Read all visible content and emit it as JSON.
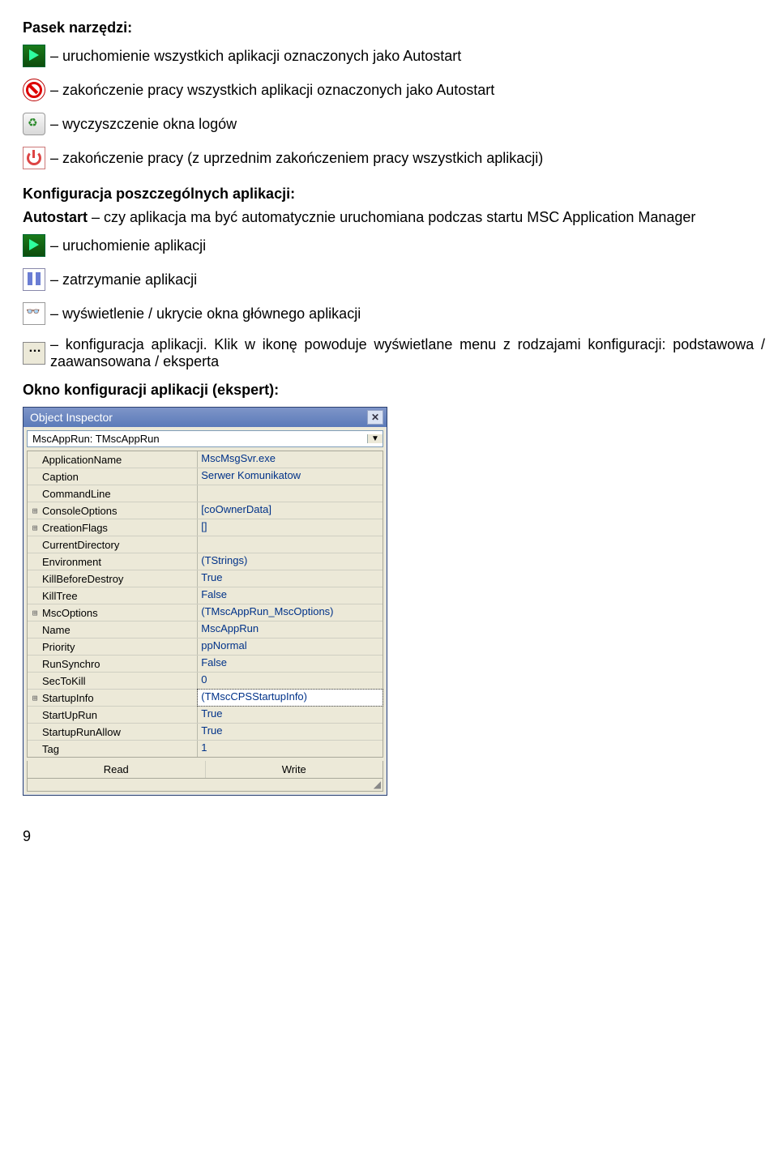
{
  "sections": {
    "toolbar_title": "Pasek narzędzi:",
    "run_all": "– uruchomienie wszystkich aplikacji oznaczonych jako Autostart",
    "stop_all": "– zakończenie pracy wszystkich aplikacji oznaczonych jako Autostart",
    "clear_logs": "– wyczyszczenie okna logów",
    "shutdown": "– zakończenie pracy (z uprzednim zakończeniem pracy wszystkich aplikacji)",
    "config_title": "Konfiguracja poszczególnych aplikacji:",
    "autostart_para": "Autostart – czy aplikacja ma być automatycznie uruchomiana podczas startu MSC Application Manager",
    "autostart_bold": "Autostart",
    "run_app": "– uruchomienie aplikacji",
    "pause_app": "– zatrzymanie aplikacji",
    "show_hide": "– wyświetlenie / ukrycie okna głównego aplikacji",
    "config_app": "– konfiguracja aplikacji. Klik w ikonę powoduje wyświetlane menu z rodzajami konfiguracji: podstawowa / zaawansowana / eksperta",
    "config_expert_title": "Okno konfiguracji aplikacji (ekspert):"
  },
  "inspector": {
    "title": "Object Inspector",
    "dropdown": "MscAppRun: TMscAppRun",
    "rows": [
      {
        "tree": " ",
        "name": "ApplicationName",
        "value": "MscMsgSvr.exe"
      },
      {
        "tree": " ",
        "name": "Caption",
        "value": "Serwer Komunikatow"
      },
      {
        "tree": " ",
        "name": "CommandLine",
        "value": ""
      },
      {
        "tree": "+",
        "name": "ConsoleOptions",
        "value": "[coOwnerData]"
      },
      {
        "tree": "+",
        "name": "CreationFlags",
        "value": "[]"
      },
      {
        "tree": " ",
        "name": "CurrentDirectory",
        "value": ""
      },
      {
        "tree": " ",
        "name": "Environment",
        "value": "(TStrings)"
      },
      {
        "tree": " ",
        "name": "KillBeforeDestroy",
        "value": "True"
      },
      {
        "tree": " ",
        "name": "KillTree",
        "value": "False"
      },
      {
        "tree": "+",
        "name": "MscOptions",
        "value": "(TMscAppRun_MscOptions)"
      },
      {
        "tree": " ",
        "name": "Name",
        "value": "MscAppRun"
      },
      {
        "tree": " ",
        "name": "Priority",
        "value": "ppNormal"
      },
      {
        "tree": " ",
        "name": "RunSynchro",
        "value": "False"
      },
      {
        "tree": " ",
        "name": "SecToKill",
        "value": "0"
      },
      {
        "tree": "+",
        "name": "StartupInfo",
        "value": "(TMscCPSStartupInfo)",
        "selected": true
      },
      {
        "tree": " ",
        "name": "StartUpRun",
        "value": "True"
      },
      {
        "tree": " ",
        "name": "StartupRunAllow",
        "value": "True"
      },
      {
        "tree": " ",
        "name": "Tag",
        "value": "1"
      }
    ],
    "tab_read": "Read",
    "tab_write": "Write"
  },
  "page_num": "9"
}
